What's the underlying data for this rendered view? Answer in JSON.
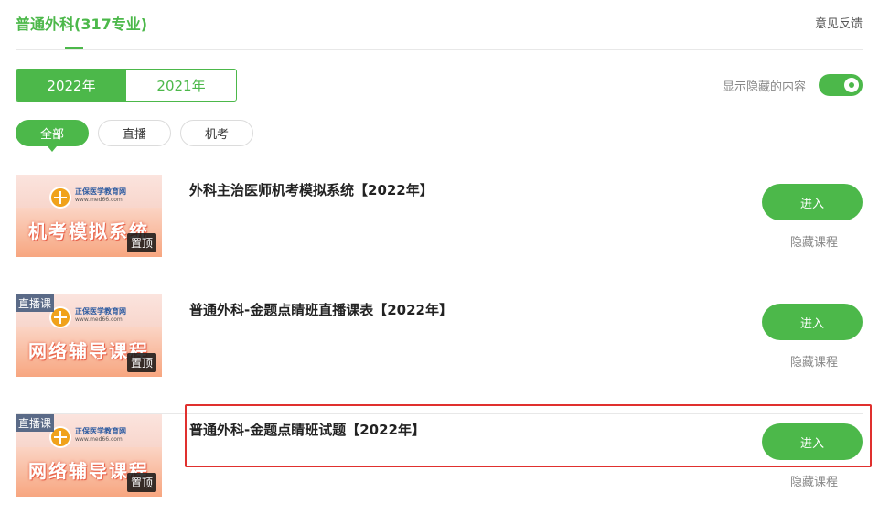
{
  "header": {
    "title": "普通外科(317专业)",
    "feedback_label": "意见反馈"
  },
  "year_tabs": [
    {
      "label": "2022年",
      "active": true
    },
    {
      "label": "2021年",
      "active": false
    }
  ],
  "show_hidden": {
    "label": "显示隐藏的内容",
    "enabled": true
  },
  "filter_chips": [
    {
      "label": "全部",
      "active": true
    },
    {
      "label": "直播",
      "active": false
    },
    {
      "label": "机考",
      "active": false
    }
  ],
  "colors": {
    "accent": "#4cb84a",
    "highlight_border": "#e0302e"
  },
  "courses": [
    {
      "title": "外科主治医师机考模拟系统【2022年】",
      "thumb_site_name": "正保医学教育网",
      "thumb_site_url": "www.med66.com",
      "thumb_banner": "机考模拟系统",
      "thumb_badge": "",
      "pin_label": "置顶",
      "enter_label": "进入",
      "hide_label": "隐藏课程"
    },
    {
      "title": "普通外科-金题点睛班直播课表【2022年】",
      "thumb_site_name": "正保医学教育网",
      "thumb_site_url": "www.med66.com",
      "thumb_banner": "网络辅导课程",
      "thumb_badge": "直播课",
      "pin_label": "置顶",
      "enter_label": "进入",
      "hide_label": "隐藏课程"
    },
    {
      "title": "普通外科-金题点睛班试题【2022年】",
      "thumb_site_name": "正保医学教育网",
      "thumb_site_url": "www.med66.com",
      "thumb_banner": "网络辅导课程",
      "thumb_badge": "直播课",
      "pin_label": "置顶",
      "enter_label": "进入",
      "hide_label": "隐藏课程"
    }
  ]
}
